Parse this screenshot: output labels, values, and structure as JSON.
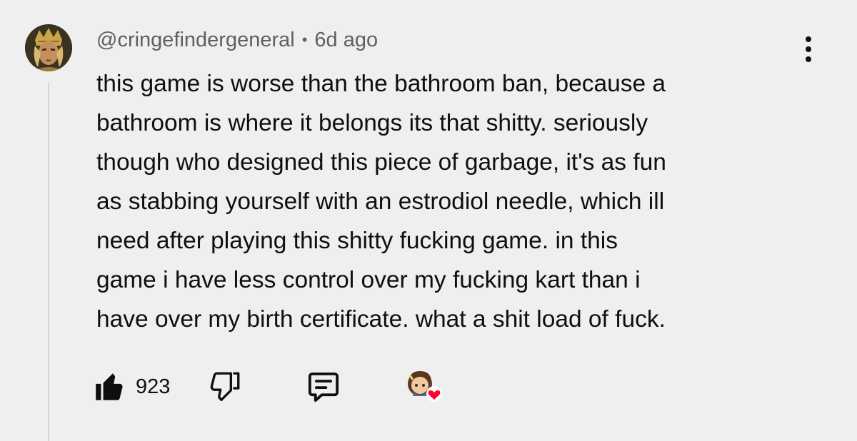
{
  "comment": {
    "username": "@cringefindergeneral",
    "separator": "•",
    "timestamp": "6d ago",
    "text_lines": [
      "this game is worse than the bathroom ban, because a",
      "bathroom is where it belongs its that shitty. seriously",
      "though who designed this piece of garbage, it's as fun",
      "as stabbing yourself with an estrodiol needle, which ill",
      "need after playing this shitty fucking game. in this",
      "game i have less control over my fucking kart than i",
      "have over my birth certificate. what a shit load of fuck."
    ],
    "likes": "923"
  },
  "icons": {
    "like": "thumbs-up-filled-icon",
    "dislike": "thumbs-down-outline-icon",
    "reply": "comment-reply-icon",
    "menu": "more-vertical-icon",
    "creator_heart": "creator-heart-icon"
  },
  "colors": {
    "background": "#efefef",
    "text": "#0f0f0f",
    "meta": "#606060",
    "heart": "#ff0033"
  }
}
